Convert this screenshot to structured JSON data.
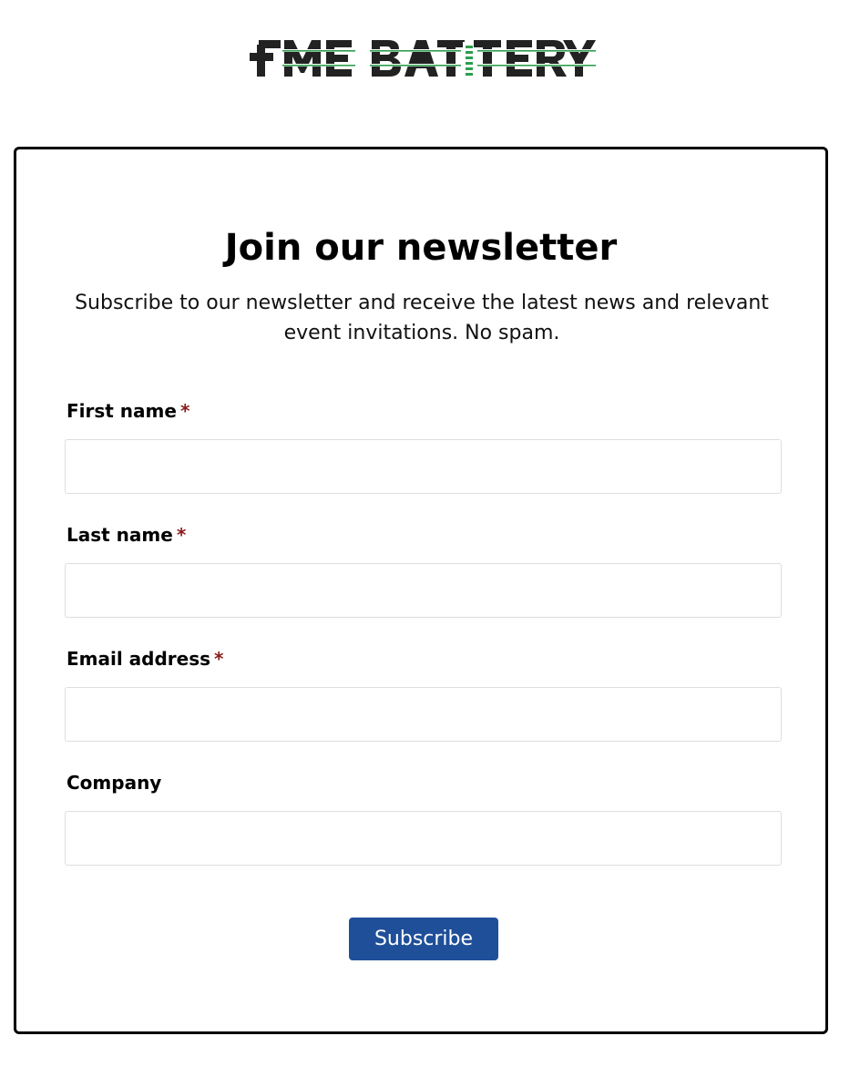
{
  "brand": {
    "logo_text": "FME BATTERY",
    "colors": {
      "dark": "#222222",
      "green": "#2e9e4f"
    }
  },
  "form": {
    "title": "Join our newsletter",
    "subtitle": "Subscribe to our newsletter and receive the latest news and relevant event invitations. No spam.",
    "fields": [
      {
        "label": "First name",
        "required": true,
        "required_mark": "*",
        "value": ""
      },
      {
        "label": "Last name",
        "required": true,
        "required_mark": "*",
        "value": ""
      },
      {
        "label": "Email address",
        "required": true,
        "required_mark": "*",
        "value": ""
      },
      {
        "label": "Company",
        "required": false,
        "value": ""
      }
    ],
    "submit_label": "Subscribe"
  },
  "colors": {
    "button": "#1f4f99",
    "required": "#8b1a1a",
    "card_border": "#000000",
    "input_border": "#dedede"
  }
}
